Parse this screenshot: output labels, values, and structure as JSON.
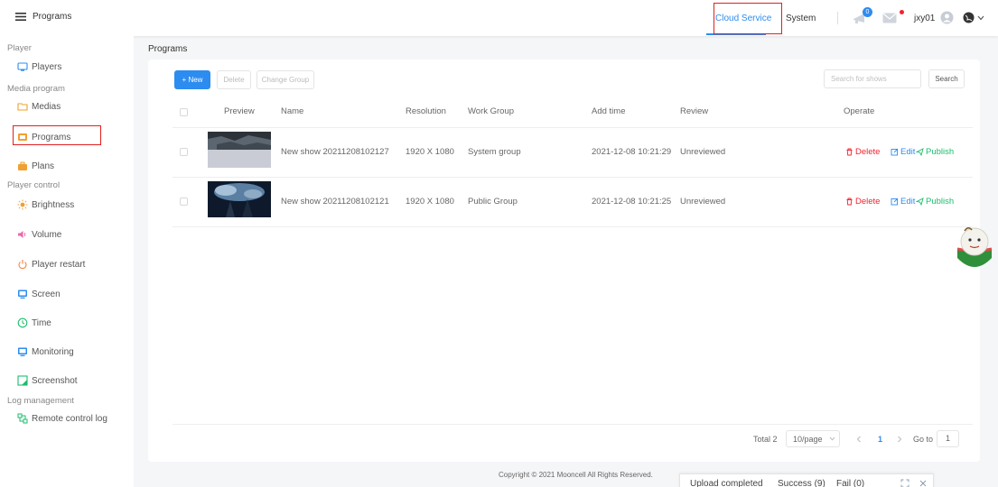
{
  "header": {
    "brand": "Programs",
    "nav": {
      "cloud_service": "Cloud Service",
      "system": "System"
    },
    "notification_count": "0",
    "username": "jxy01"
  },
  "sidebar": {
    "sections": [
      {
        "title": "Player",
        "items": [
          {
            "label": "Players",
            "icon": "monitor-icon"
          }
        ]
      },
      {
        "title": "Media program",
        "items": [
          {
            "label": "Medias",
            "icon": "folder-icon"
          },
          {
            "label": "Programs",
            "icon": "program-icon",
            "active": true
          },
          {
            "label": "Plans",
            "icon": "briefcase-icon"
          }
        ]
      },
      {
        "title": "Player control",
        "items": [
          {
            "label": "Brightness",
            "icon": "sun-icon"
          },
          {
            "label": "Volume",
            "icon": "speaker-icon"
          },
          {
            "label": "Player restart",
            "icon": "power-icon"
          },
          {
            "label": "Screen",
            "icon": "screen-icon"
          },
          {
            "label": "Time",
            "icon": "clock-icon"
          },
          {
            "label": "Monitoring",
            "icon": "monitor-icon"
          },
          {
            "label": "Screenshot",
            "icon": "screenshot-icon"
          }
        ]
      },
      {
        "title": "Log management",
        "items": [
          {
            "label": "Remote control log",
            "icon": "log-icon"
          }
        ]
      }
    ]
  },
  "breadcrumb": "Programs",
  "toolbar": {
    "new_label": "+ New",
    "delete_label": "Delete",
    "change_group_label": "Change Group",
    "search_placeholder": "Search for shows",
    "search_label": "Search"
  },
  "table": {
    "columns": [
      "Preview",
      "Name",
      "Resolution",
      "Work Group",
      "Add time",
      "Review",
      "Operate"
    ],
    "rows": [
      {
        "name": "New show 20211208102127",
        "resolution": "1920 X 1080",
        "work_group": "System group",
        "add_time": "2021-12-08 10:21:29",
        "review": "Unreviewed"
      },
      {
        "name": "New show 20211208102121",
        "resolution": "1920 X 1080",
        "work_group": "Public Group",
        "add_time": "2021-12-08 10:21:25",
        "review": "Unreviewed"
      }
    ],
    "actions": {
      "delete": "Delete",
      "edit": "Edit",
      "publish": "Publish"
    }
  },
  "pagination": {
    "total": "Total 2",
    "page_size": "10/page",
    "current_page": "1",
    "goto_label": "Go to",
    "goto_value": "1"
  },
  "footer": {
    "copyright": "Copyright © 2021 Mooncell All Rights Reserved."
  },
  "upload": {
    "status": "Upload completed",
    "success": "Success (9)",
    "fail": "Fail (0)"
  },
  "colors": {
    "accent": "#2d8cf0",
    "danger": "#f5222d",
    "success": "#19be6b",
    "sidebar_icon": "#f0a030"
  }
}
